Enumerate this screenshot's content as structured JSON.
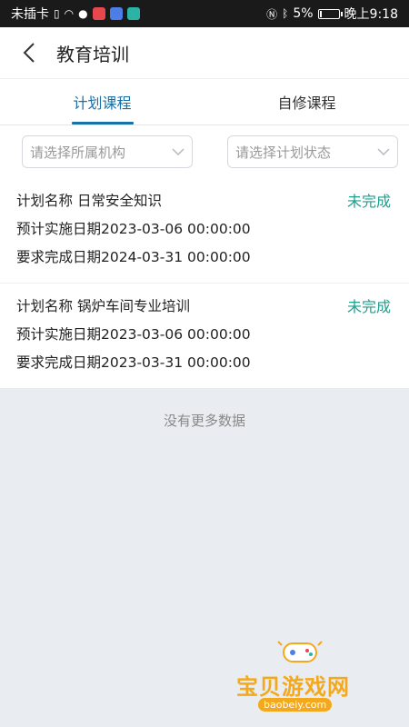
{
  "status_bar": {
    "left_text": "未插卡",
    "battery": "5%",
    "battery_level": 0.05,
    "time": "晚上9:18"
  },
  "header": {
    "title": "教育培训"
  },
  "tabs": [
    {
      "label": "计划课程",
      "active": true
    },
    {
      "label": "自修课程",
      "active": false
    }
  ],
  "filters": {
    "org_placeholder": "请选择所属机构",
    "status_placeholder": "请选择计划状态"
  },
  "plans": [
    {
      "name_label": "计划名称",
      "name": "日常安全知识",
      "status": "未完成",
      "start_label": "预计实施日期",
      "start": "2023-03-06 00:00:00",
      "due_label": "要求完成日期",
      "due": "2024-03-31 00:00:00"
    },
    {
      "name_label": "计划名称",
      "name": "锅炉车间专业培训",
      "status": "未完成",
      "start_label": "预计实施日期",
      "start": "2023-03-06 00:00:00",
      "due_label": "要求完成日期",
      "due": "2023-03-31 00:00:00"
    }
  ],
  "footer": {
    "no_more": "没有更多数据"
  },
  "watermark": {
    "text": "宝贝游戏网",
    "url": "baobeiy.com"
  },
  "colors": {
    "accent": "#1a6fa6",
    "status": "#1e9e8c",
    "watermark": "#f4a81c"
  }
}
